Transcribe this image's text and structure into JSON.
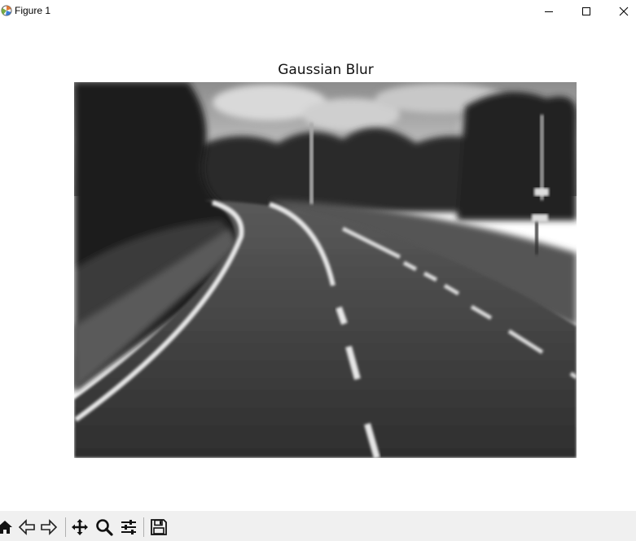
{
  "window": {
    "title": "Figure 1"
  },
  "figure": {
    "title": "Gaussian Blur"
  },
  "image": {
    "description_icon": "blurred-grayscale-road-photo"
  },
  "toolbar": {
    "buttons": [
      "home-icon",
      "back-icon",
      "forward-icon",
      "pan-icon",
      "zoom-icon",
      "configure-subplots-icon",
      "save-icon"
    ]
  }
}
